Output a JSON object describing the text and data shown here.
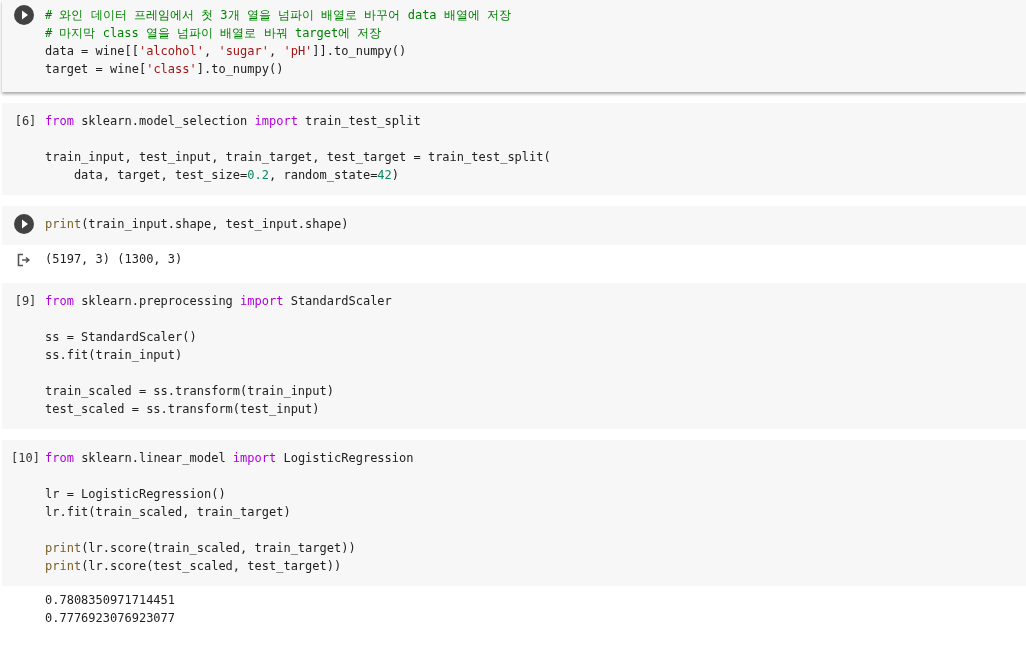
{
  "cells": [
    {
      "gutter": {
        "kind": "run"
      },
      "focused": true,
      "lines": [
        {
          "kind": "code",
          "tokens": [
            {
              "t": "# 와인 데이터 프레임에서 첫 3개 열을 넘파이 배열로 바꾸어 data 배열에 저장",
              "kind": "comment"
            }
          ]
        },
        {
          "kind": "code",
          "tokens": [
            {
              "t": "# 마지막 class 열을 넘파이 배열로 바꿔 target에 저장",
              "kind": "comment"
            }
          ]
        },
        {
          "kind": "code",
          "tokens": [
            {
              "t": "data = wine[[",
              "kind": "plain"
            },
            {
              "t": "'alcohol'",
              "kind": "string"
            },
            {
              "t": ", ",
              "kind": "plain"
            },
            {
              "t": "'sugar'",
              "kind": "string"
            },
            {
              "t": ", ",
              "kind": "plain"
            },
            {
              "t": "'pH'",
              "kind": "string"
            },
            {
              "t": "]].to_numpy()",
              "kind": "plain"
            }
          ]
        },
        {
          "kind": "code",
          "tokens": [
            {
              "t": "target = wine[",
              "kind": "plain"
            },
            {
              "t": "'class'",
              "kind": "string"
            },
            {
              "t": "].to_numpy()",
              "kind": "plain"
            }
          ]
        }
      ]
    },
    {
      "gutter": {
        "kind": "count",
        "label": "[6]"
      },
      "focused": false,
      "lines": [
        {
          "kind": "code",
          "tokens": [
            {
              "t": "from",
              "kind": "keyword"
            },
            {
              "t": " sklearn.model_selection ",
              "kind": "plain"
            },
            {
              "t": "import",
              "kind": "keyword"
            },
            {
              "t": " train_test_split",
              "kind": "plain"
            }
          ]
        },
        {
          "kind": "blank"
        },
        {
          "kind": "code",
          "tokens": [
            {
              "t": "train_input, test_input, train_target, test_target = train_test_split(",
              "kind": "plain"
            }
          ]
        },
        {
          "kind": "code",
          "tokens": [
            {
              "t": "    data, target, test_size=",
              "kind": "plain"
            },
            {
              "t": "0.2",
              "kind": "number"
            },
            {
              "t": ", random_state=",
              "kind": "plain"
            },
            {
              "t": "42",
              "kind": "number"
            },
            {
              "t": ")",
              "kind": "plain"
            }
          ]
        }
      ]
    },
    {
      "gutter": {
        "kind": "run"
      },
      "focused": false,
      "lines": [
        {
          "kind": "code",
          "tokens": [
            {
              "t": "print",
              "kind": "builtin"
            },
            {
              "t": "(train_input.shape, test_input.shape)",
              "kind": "plain"
            }
          ]
        }
      ],
      "output": {
        "kind": "stream",
        "lines": [
          "(5197, 3) (1300, 3)"
        ]
      }
    },
    {
      "gutter": {
        "kind": "count",
        "label": "[9]"
      },
      "focused": false,
      "lines": [
        {
          "kind": "code",
          "tokens": [
            {
              "t": "from",
              "kind": "keyword"
            },
            {
              "t": " sklearn.preprocessing ",
              "kind": "plain"
            },
            {
              "t": "import",
              "kind": "keyword"
            },
            {
              "t": " StandardScaler",
              "kind": "plain"
            }
          ]
        },
        {
          "kind": "blank"
        },
        {
          "kind": "code",
          "tokens": [
            {
              "t": "ss = StandardScaler()",
              "kind": "plain"
            }
          ]
        },
        {
          "kind": "code",
          "tokens": [
            {
              "t": "ss.fit(train_input)",
              "kind": "plain"
            }
          ]
        },
        {
          "kind": "blank"
        },
        {
          "kind": "code",
          "tokens": [
            {
              "t": "train_scaled = ss.transform(train_input)",
              "kind": "plain"
            }
          ]
        },
        {
          "kind": "code",
          "tokens": [
            {
              "t": "test_scaled = ss.transform(test_input)",
              "kind": "plain"
            }
          ]
        }
      ]
    },
    {
      "gutter": {
        "kind": "count",
        "label": "[10]"
      },
      "focused": false,
      "lines": [
        {
          "kind": "code",
          "tokens": [
            {
              "t": "from",
              "kind": "keyword"
            },
            {
              "t": " sklearn.linear_model ",
              "kind": "plain"
            },
            {
              "t": "import",
              "kind": "keyword"
            },
            {
              "t": " LogisticRegression",
              "kind": "plain"
            }
          ]
        },
        {
          "kind": "blank"
        },
        {
          "kind": "code",
          "tokens": [
            {
              "t": "lr = LogisticRegression()",
              "kind": "plain"
            }
          ]
        },
        {
          "kind": "code",
          "tokens": [
            {
              "t": "lr.fit(train_scaled, train_target)",
              "kind": "plain"
            }
          ]
        },
        {
          "kind": "blank"
        },
        {
          "kind": "code",
          "tokens": [
            {
              "t": "print",
              "kind": "builtin"
            },
            {
              "t": "(lr.score(train_scaled, train_target))",
              "kind": "plain"
            }
          ]
        },
        {
          "kind": "code",
          "tokens": [
            {
              "t": "print",
              "kind": "builtin"
            },
            {
              "t": "(lr.score(test_scaled, test_target))",
              "kind": "plain"
            }
          ]
        }
      ],
      "output": {
        "kind": "result",
        "lines": [
          "0.7808350971714451",
          "0.7776923076923077"
        ]
      }
    }
  ]
}
